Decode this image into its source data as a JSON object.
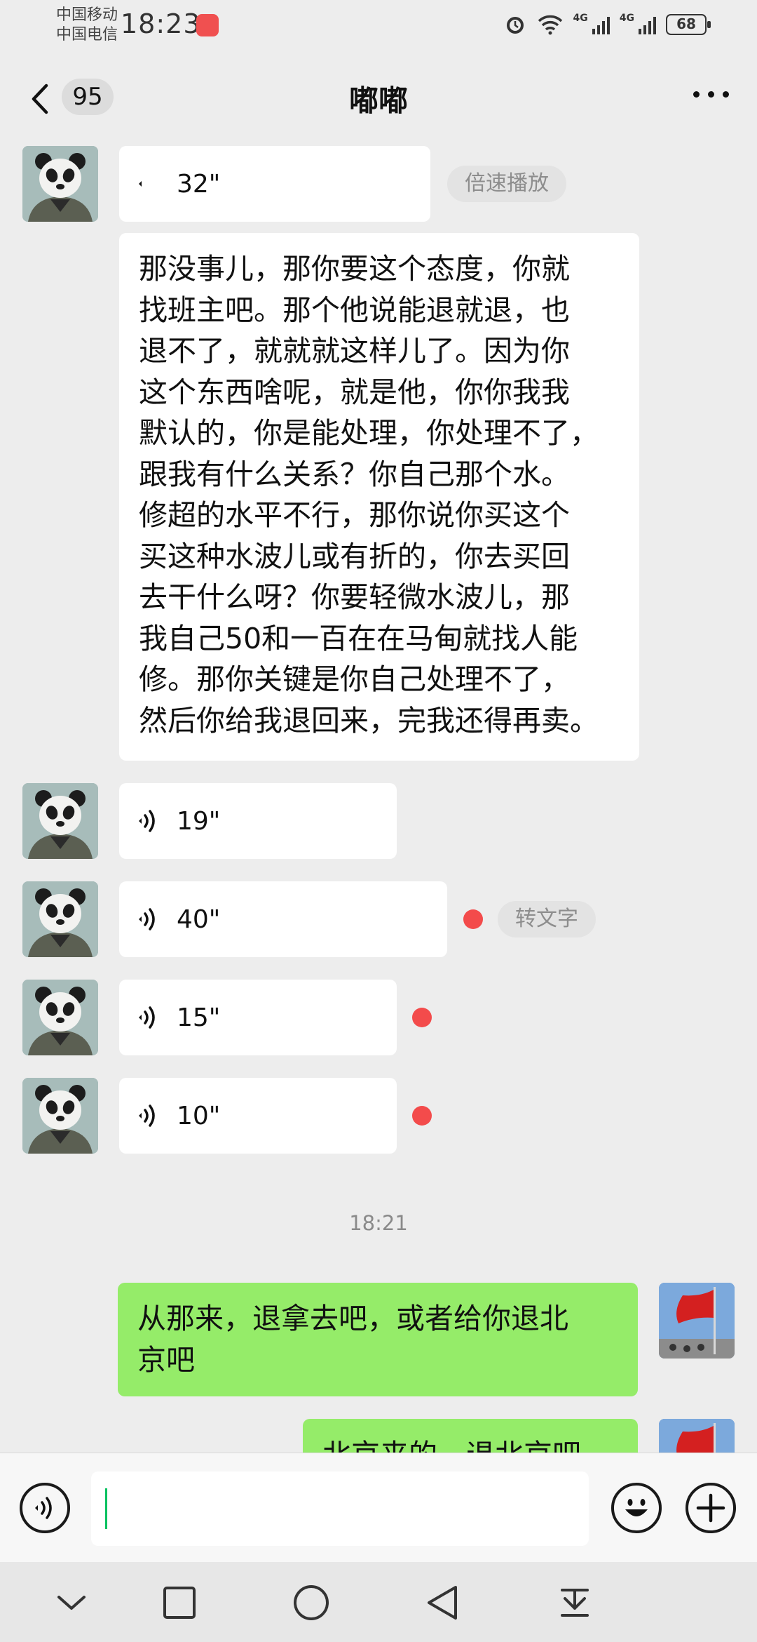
{
  "status_bar": {
    "carrier_1": "中国移动",
    "carrier_2": "中国电信",
    "time": "18:23",
    "network_1": "4G",
    "network_2": "4G",
    "battery": "68"
  },
  "header": {
    "unread_count": "95",
    "title": "嘟嘟"
  },
  "messages": {
    "voice_1": {
      "duration": "32\"",
      "speed_label": "倍速播放"
    },
    "transcript": {
      "lines": [
        "那没事儿，那你要这个态度，你就",
        "找班主吧。那个他说能退就退，也",
        "退不了，就就就这样儿了。因为你",
        "这个东西啥呢，就是他，你你我我",
        "默认的，你是能处理，你处理不了，",
        "跟我有什么关系？你自己那个水。",
        "修超的水平不行，那你说你买这个",
        "买这种水波儿或有折的，你去买回",
        "去干什么呀？你要轻微水波儿，那",
        "我自己50和一百在在马甸就找人能",
        "修。那你关键是你自己处理不了，",
        "然后你给我退回来，完我还得再卖。"
      ]
    },
    "voice_2": {
      "duration": "19\""
    },
    "voice_3": {
      "duration": "40\"",
      "transcribe_label": "转文字"
    },
    "voice_4": {
      "duration": "15\""
    },
    "voice_5": {
      "duration": "10\""
    },
    "timestamp": "18:21",
    "sent_1": {
      "lines": [
        "从那来，退拿去吧，或者给你退北",
        "京吧"
      ]
    },
    "sent_2": {
      "text": "北京来的，退北京吧"
    }
  },
  "colors": {
    "sent_bubble": "#95ec69",
    "received_bubble": "#ffffff",
    "background": "#ededed",
    "unread_dot": "#f34b4b",
    "caret": "#07c160"
  },
  "icons": [
    "back-icon",
    "more-icon",
    "voice-wave-icon",
    "voice-mode-icon",
    "emoji-icon",
    "plus-icon",
    "nav-collapse-icon",
    "nav-recent-icon",
    "nav-home-icon",
    "nav-back-icon",
    "nav-notification-icon"
  ]
}
